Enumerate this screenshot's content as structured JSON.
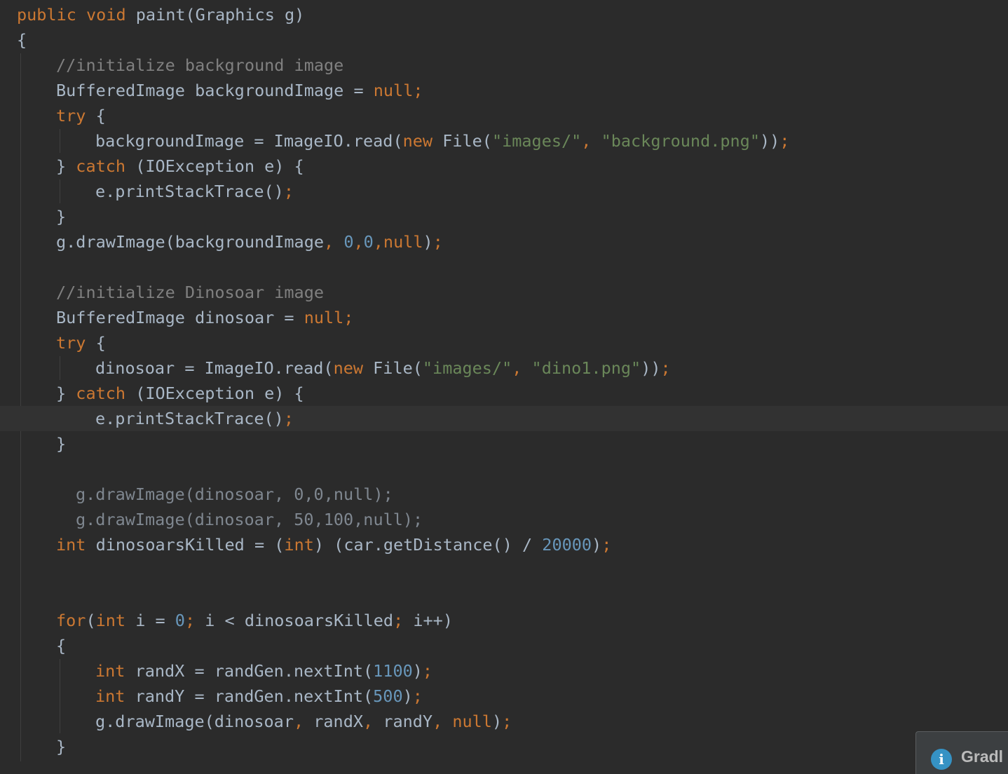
{
  "editor": {
    "theme_colors": {
      "background": "#2b2b2b",
      "current_line": "#323232",
      "keyword": "#cc7832",
      "string": "#6a8759",
      "number": "#6897bb",
      "comment": "#808080",
      "plain": "#a9b7c6"
    },
    "lines": [
      {
        "indent": 0,
        "tokens": [
          {
            "t": "public void ",
            "c": "kw"
          },
          {
            "t": "paint(Graphics g)",
            "c": "p"
          }
        ]
      },
      {
        "indent": 0,
        "tokens": [
          {
            "t": "{",
            "c": "p"
          }
        ]
      },
      {
        "indent": 2,
        "tokens": [
          {
            "t": "//initialize background image",
            "c": "cmt"
          }
        ]
      },
      {
        "indent": 2,
        "tokens": [
          {
            "t": "BufferedImage backgroundImage = ",
            "c": "p"
          },
          {
            "t": "null;",
            "c": "kw"
          }
        ]
      },
      {
        "indent": 2,
        "tokens": [
          {
            "t": "try ",
            "c": "kw"
          },
          {
            "t": "{",
            "c": "p"
          }
        ]
      },
      {
        "indent": 4,
        "tokens": [
          {
            "t": "backgroundImage = ImageIO.read(",
            "c": "p"
          },
          {
            "t": "new ",
            "c": "kw"
          },
          {
            "t": "File(",
            "c": "p"
          },
          {
            "t": "\"images/\"",
            "c": "str"
          },
          {
            "t": ", ",
            "c": "kw"
          },
          {
            "t": "\"background.png\"",
            "c": "str"
          },
          {
            "t": "))",
            "c": "p"
          },
          {
            "t": ";",
            "c": "kw"
          }
        ]
      },
      {
        "indent": 2,
        "tokens": [
          {
            "t": "} ",
            "c": "p"
          },
          {
            "t": "catch ",
            "c": "kw"
          },
          {
            "t": "(IOException e) {",
            "c": "p"
          }
        ]
      },
      {
        "indent": 4,
        "tokens": [
          {
            "t": "e.printStackTrace()",
            "c": "p"
          },
          {
            "t": ";",
            "c": "kw"
          }
        ]
      },
      {
        "indent": 2,
        "tokens": [
          {
            "t": "}",
            "c": "p"
          }
        ]
      },
      {
        "indent": 2,
        "tokens": [
          {
            "t": "g.drawImage(backgroundImage",
            "c": "p"
          },
          {
            "t": ", ",
            "c": "kw"
          },
          {
            "t": "0",
            "c": "num"
          },
          {
            "t": ",",
            "c": "kw"
          },
          {
            "t": "0",
            "c": "num"
          },
          {
            "t": ",null",
            "c": "kw"
          },
          {
            "t": ")",
            "c": "p"
          },
          {
            "t": ";",
            "c": "kw"
          }
        ]
      },
      {
        "indent": 0,
        "tokens": []
      },
      {
        "indent": 2,
        "tokens": [
          {
            "t": "//initialize Dinosoar image",
            "c": "cmt"
          }
        ]
      },
      {
        "indent": 2,
        "tokens": [
          {
            "t": "BufferedImage dinosoar = ",
            "c": "p"
          },
          {
            "t": "null;",
            "c": "kw"
          }
        ]
      },
      {
        "indent": 2,
        "tokens": [
          {
            "t": "try ",
            "c": "kw"
          },
          {
            "t": "{",
            "c": "p"
          }
        ]
      },
      {
        "indent": 4,
        "tokens": [
          {
            "t": "dinosoar = ImageIO.read(",
            "c": "p"
          },
          {
            "t": "new ",
            "c": "kw"
          },
          {
            "t": "File(",
            "c": "p"
          },
          {
            "t": "\"images/\"",
            "c": "str"
          },
          {
            "t": ", ",
            "c": "kw"
          },
          {
            "t": "\"dino1.png\"",
            "c": "str"
          },
          {
            "t": "))",
            "c": "p"
          },
          {
            "t": ";",
            "c": "kw"
          }
        ]
      },
      {
        "indent": 2,
        "tokens": [
          {
            "t": "} ",
            "c": "p"
          },
          {
            "t": "catch ",
            "c": "kw"
          },
          {
            "t": "(IOException e) {",
            "c": "p"
          }
        ]
      },
      {
        "indent": 4,
        "current": true,
        "tokens": [
          {
            "t": "e.printStackTrace()",
            "c": "p"
          },
          {
            "t": ";",
            "c": "kw"
          }
        ]
      },
      {
        "indent": 2,
        "tokens": [
          {
            "t": "}",
            "c": "p"
          }
        ]
      },
      {
        "indent": 0,
        "tokens": []
      },
      {
        "indent": 3,
        "tokens": [
          {
            "t": "g.drawImage(dinosoar, 0,0,null);",
            "c": "dim"
          }
        ]
      },
      {
        "indent": 3,
        "tokens": [
          {
            "t": "g.drawImage(dinosoar, 50,100,null);",
            "c": "dim"
          }
        ]
      },
      {
        "indent": 2,
        "tokens": [
          {
            "t": "int ",
            "c": "kw"
          },
          {
            "t": "dinosoarsKilled = (",
            "c": "p"
          },
          {
            "t": "int",
            "c": "kw"
          },
          {
            "t": ") (car.getDistance() / ",
            "c": "p"
          },
          {
            "t": "20000",
            "c": "num"
          },
          {
            "t": ")",
            "c": "p"
          },
          {
            "t": ";",
            "c": "kw"
          }
        ]
      },
      {
        "indent": 0,
        "tokens": []
      },
      {
        "indent": 0,
        "tokens": []
      },
      {
        "indent": 2,
        "tokens": [
          {
            "t": "for",
            "c": "kw"
          },
          {
            "t": "(",
            "c": "p"
          },
          {
            "t": "int ",
            "c": "kw"
          },
          {
            "t": "i = ",
            "c": "p"
          },
          {
            "t": "0",
            "c": "num"
          },
          {
            "t": "; ",
            "c": "kw"
          },
          {
            "t": "i < dinosoarsKilled",
            "c": "p"
          },
          {
            "t": "; ",
            "c": "kw"
          },
          {
            "t": "i++)",
            "c": "p"
          }
        ]
      },
      {
        "indent": 2,
        "tokens": [
          {
            "t": "{",
            "c": "p"
          }
        ]
      },
      {
        "indent": 4,
        "tokens": [
          {
            "t": "int ",
            "c": "kw"
          },
          {
            "t": "randX = randGen.nextInt(",
            "c": "p"
          },
          {
            "t": "1100",
            "c": "num"
          },
          {
            "t": ")",
            "c": "p"
          },
          {
            "t": ";",
            "c": "kw"
          }
        ]
      },
      {
        "indent": 4,
        "tokens": [
          {
            "t": "int ",
            "c": "kw"
          },
          {
            "t": "randY = randGen.nextInt(",
            "c": "p"
          },
          {
            "t": "500",
            "c": "num"
          },
          {
            "t": ")",
            "c": "p"
          },
          {
            "t": ";",
            "c": "kw"
          }
        ]
      },
      {
        "indent": 4,
        "tokens": [
          {
            "t": "g.drawImage(dinosoar",
            "c": "p"
          },
          {
            "t": ", ",
            "c": "kw"
          },
          {
            "t": "randX",
            "c": "p"
          },
          {
            "t": ", ",
            "c": "kw"
          },
          {
            "t": "randY",
            "c": "p"
          },
          {
            "t": ", ",
            "c": "kw"
          },
          {
            "t": "null",
            "c": "kw"
          },
          {
            "t": ")",
            "c": "p"
          },
          {
            "t": ";",
            "c": "kw"
          }
        ]
      },
      {
        "indent": 2,
        "tokens": [
          {
            "t": "}",
            "c": "p"
          }
        ]
      }
    ]
  },
  "notification": {
    "icon": "info-icon",
    "icon_glyph": "i",
    "title": "Gradl"
  }
}
